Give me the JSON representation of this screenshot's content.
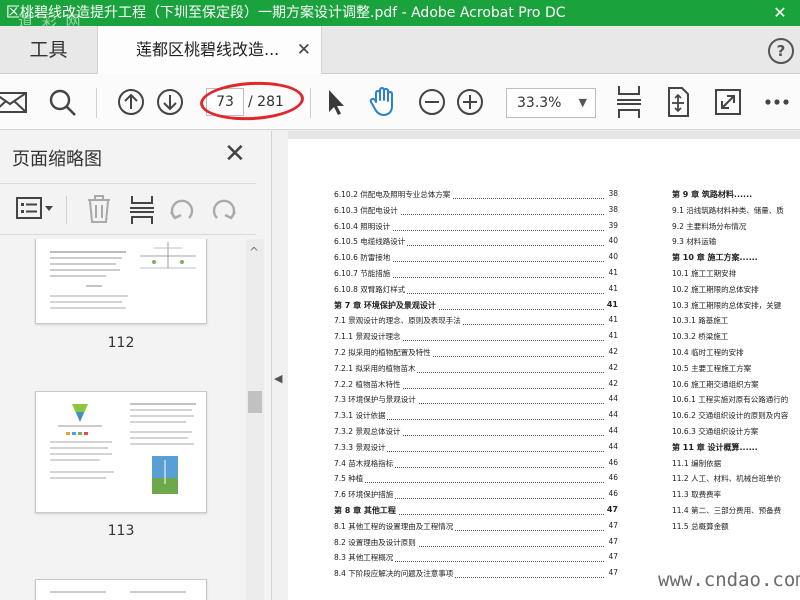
{
  "window": {
    "title": "区桃碧线改造提升工程（下圳至保定段）一期方案设计调整.pdf - Adobe Acrobat Pro DC",
    "watermark": "道 彩 网",
    "close_glyph": "✕"
  },
  "tabs": {
    "tools_label": "工具",
    "doc_label": "莲都区桃碧线改造...",
    "close_glyph": "✕",
    "help_glyph": "?"
  },
  "toolbar": {
    "current_page": "73",
    "total_pages": "/ 281",
    "zoom": "33.3%",
    "zoom_dropdown": "▼",
    "highlight_color": "#e2262b"
  },
  "sidebar": {
    "title": "页面缩略图",
    "close_glyph": "✕",
    "thumbnails": [
      {
        "label": "112"
      },
      {
        "label": "113"
      }
    ]
  },
  "document": {
    "toc_left": [
      {
        "label": "6.10.2 供配电及照明专业总体方案",
        "page": "38",
        "bold": false
      },
      {
        "label": "6.10.3 供配电设计",
        "page": "38",
        "bold": false
      },
      {
        "label": "6.10.4 照明设计",
        "page": "39",
        "bold": false
      },
      {
        "label": "6.10.5 电缆线路设计",
        "page": "40",
        "bold": false
      },
      {
        "label": "6.10.6 防雷接地",
        "page": "40",
        "bold": false
      },
      {
        "label": "6.10.7 节能措施",
        "page": "41",
        "bold": false
      },
      {
        "label": "6.10.8 双臂路灯样式",
        "page": "41",
        "bold": false
      },
      {
        "label": "第 7 章 环境保护及景观设计",
        "page": "41",
        "bold": true
      },
      {
        "label": "7.1 景观设计的理念、原则及表现手法",
        "page": "41",
        "bold": false
      },
      {
        "label": "7.1.1 景观设计理念",
        "page": "41",
        "bold": false
      },
      {
        "label": "7.2 拟采用的植物配置及特性",
        "page": "42",
        "bold": false
      },
      {
        "label": "7.2.1 拟采用的植物苗木",
        "page": "42",
        "bold": false
      },
      {
        "label": "7.2.2 植物苗木特性",
        "page": "42",
        "bold": false
      },
      {
        "label": "7.3 环境保护与景观设计",
        "page": "44",
        "bold": false
      },
      {
        "label": "7.3.1 设计依据",
        "page": "44",
        "bold": false
      },
      {
        "label": "7.3.2 景观总体设计",
        "page": "44",
        "bold": false
      },
      {
        "label": "7.3.3 景观设计",
        "page": "44",
        "bold": false
      },
      {
        "label": "7.4 苗木规格指标",
        "page": "46",
        "bold": false
      },
      {
        "label": "7.5 种植",
        "page": "46",
        "bold": false
      },
      {
        "label": "7.6 环境保护措施",
        "page": "46",
        "bold": false
      },
      {
        "label": "第 8 章 其他工程",
        "page": "47",
        "bold": true
      },
      {
        "label": "8.1 其他工程的设置理由及工程情况",
        "page": "47",
        "bold": false
      },
      {
        "label": "8.2 设置理由及设计原则",
        "page": "47",
        "bold": false
      },
      {
        "label": "8.3 其他工程概况",
        "page": "47",
        "bold": false
      },
      {
        "label": "8.4 下阶段应解决的问题及注意事项",
        "page": "47",
        "bold": false
      }
    ],
    "toc_right": [
      {
        "label": "第 9 章 筑路材料......",
        "bold": true
      },
      {
        "label": "9.1 沿线筑路材料种类、储量、质",
        "bold": false
      },
      {
        "label": "9.2 主要料场分布情况",
        "bold": false
      },
      {
        "label": "9.3 材料运输",
        "bold": false
      },
      {
        "label": "第 10 章 施工方案......",
        "bold": true
      },
      {
        "label": "10.1 施工工期安排",
        "bold": false
      },
      {
        "label": "10.2 施工期限的总体安排",
        "bold": false
      },
      {
        "label": "10.3 施工期限的总体安排，关键",
        "bold": false
      },
      {
        "label": "10.3.1 路基施工",
        "bold": false
      },
      {
        "label": "10.3.2 桥梁施工",
        "bold": false
      },
      {
        "label": "10.4 临时工程的安排",
        "bold": false
      },
      {
        "label": "10.5 主要工程施工方案",
        "bold": false
      },
      {
        "label": "10.6 施工期交通组织方案",
        "bold": false
      },
      {
        "label": "10.6.1 工程实施对原有公路通行的",
        "bold": false
      },
      {
        "label": "10.6.2 交通组织设计的原则及内容",
        "bold": false
      },
      {
        "label": "10.6.3 交通组织设计方案",
        "bold": false
      },
      {
        "label": "第 11 章 设计概算......",
        "bold": true
      },
      {
        "label": "11.1 编制依据",
        "bold": false
      },
      {
        "label": "11.2 人工、材料、机械台班单价",
        "bold": false
      },
      {
        "label": "11.3 取费费率",
        "bold": false
      },
      {
        "label": "11.4 第二、三部分费用、预备费",
        "bold": false
      },
      {
        "label": "11.5 总概算金额",
        "bold": false
      }
    ],
    "site_watermark": "www.cndao.com"
  }
}
